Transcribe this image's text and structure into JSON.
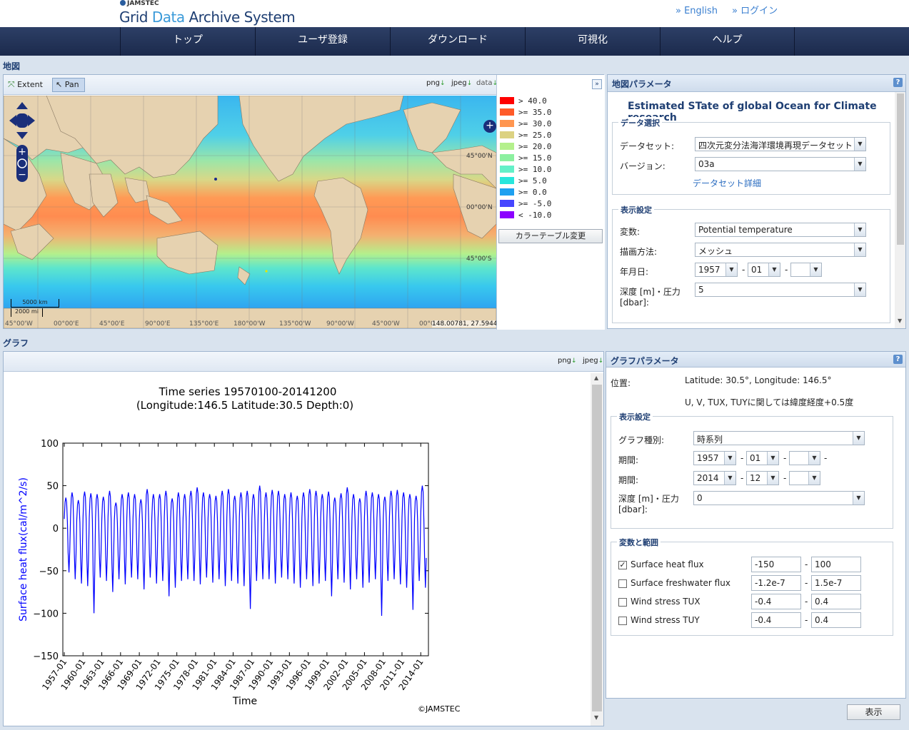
{
  "header": {
    "org": "JAMSTEC",
    "title_a": "Grid ",
    "title_b": "Data ",
    "title_c": "Archive ",
    "title_d": "System",
    "link_english": "» English",
    "link_login": "» ログイン"
  },
  "nav": [
    "トップ",
    "ユーザ登録",
    "ダウンロード",
    "可視化",
    "ヘルプ"
  ],
  "map_section": {
    "label": "地図",
    "extent_label": "Extent",
    "pan_label": "Pan",
    "png": "png",
    "jpeg": "jpeg",
    "data": "data",
    "lat_labels": [
      "45°00'N",
      "00°00'N",
      "45°00'S"
    ],
    "lon_labels": [
      "45°00'W",
      "00°00'E",
      "45°00'E",
      "90°00'E",
      "135°00'E",
      "180°00'W",
      "135°00'W",
      "90°00'W",
      "45°00'W",
      "00°0"
    ],
    "scale_km": "5000 km",
    "scale_mi": "2000 mi",
    "coords": "148.00781, 27.59440",
    "colortable_button": "カラーテーブル変更",
    "legend": [
      {
        "label": "> 40.0",
        "color": "#ff0000"
      },
      {
        "label": ">= 35.0",
        "color": "#ff5a28"
      },
      {
        "label": ">= 30.0",
        "color": "#ff9650"
      },
      {
        "label": ">= 25.0",
        "color": "#dcd282"
      },
      {
        "label": ">= 20.0",
        "color": "#b4f08c"
      },
      {
        "label": ">= 15.0",
        "color": "#8cf0a0"
      },
      {
        "label": ">= 10.0",
        "color": "#64f0c8"
      },
      {
        "label": ">= 5.0",
        "color": "#28e6dc"
      },
      {
        "label": ">= 0.0",
        "color": "#1ea0f0"
      },
      {
        "label": ">= -5.0",
        "color": "#4646ff"
      },
      {
        "label": "< -10.0",
        "color": "#8c00ff"
      }
    ]
  },
  "map_params": {
    "title": "地図パラメータ",
    "help": "?",
    "ecco_title": "Estimated STate of global Ocean for Climate research",
    "data_select_legend": "データ選択",
    "dataset_label": "データセット:",
    "dataset_value": "四次元変分法海洋環境再現データセット",
    "version_label": "バージョン:",
    "version_value": "03a",
    "dataset_detail_link": "データセット詳細",
    "display_legend": "表示設定",
    "variable_label": "変数:",
    "variable_value": "Potential temperature",
    "draw_label": "描画方法:",
    "draw_value": "メッシュ",
    "date_label": "年月日:",
    "year_value": "1957",
    "month_value": "01",
    "dash": "-",
    "depth_label_1": "深度 [m]・圧力",
    "depth_label_2": "[dbar]:",
    "depth_value": "5"
  },
  "graph_section": {
    "label": "グラフ",
    "png": "png",
    "jpeg": "jpeg",
    "copyright": "©JAMSTEC"
  },
  "graph_params": {
    "title": "グラフパラメータ",
    "help": "?",
    "position_label": "位置:",
    "position_value": "Latitude: 30.5°, Longitude: 146.5°",
    "uv_note": "U, V, TUX, TUYに関しては緯度経度+0.5度",
    "display_legend": "表示設定",
    "graph_type_label": "グラフ種別:",
    "graph_type_value": "時系列",
    "period_label": "期間:",
    "start_year": "1957",
    "start_month": "01",
    "end_year": "2014",
    "end_month": "12",
    "dash": "-",
    "depth_label_1": "深度 [m]・圧力",
    "depth_label_2": "[dbar]:",
    "depth_value": "0",
    "vars_legend": "変数と範囲",
    "variables": [
      {
        "name": "Surface heat flux",
        "checked": "✓",
        "min": "-150",
        "max": "100"
      },
      {
        "name": "Surface freshwater flux",
        "checked": "",
        "min": "-1.2e-7",
        "max": "1.5e-7"
      },
      {
        "name": "Wind stress TUX",
        "checked": "",
        "min": "-0.4",
        "max": "0.4"
      },
      {
        "name": "Wind stress TUY",
        "checked": "",
        "min": "-0.4",
        "max": "0.4"
      }
    ],
    "show_button": "表示"
  },
  "chart_data": {
    "type": "line",
    "title": "Time series 19570100-20141200",
    "subtitle": "(Longitude:146.5 Latitude:30.5 Depth:0)",
    "xlabel": "Time",
    "ylabel": "Surface heat flux(cal/m^2/s)",
    "ylim": [
      -150,
      100
    ],
    "yticks": [
      "100",
      "50",
      "0",
      "−50",
      "−100",
      "−150"
    ],
    "xticks": [
      "1957-01",
      "1960-01",
      "1963-01",
      "1966-01",
      "1969-01",
      "1972-01",
      "1975-01",
      "1978-01",
      "1981-01",
      "1984-01",
      "1987-01",
      "1990-01",
      "1993-01",
      "1996-01",
      "1999-01",
      "2002-01",
      "2005-01",
      "2008-01",
      "2011-01",
      "2014-01"
    ],
    "series": [
      {
        "name": "",
        "color": "#0000ff",
        "summer_peaks": [
          36,
          42,
          33,
          43,
          41,
          40,
          37,
          44,
          30,
          40,
          42,
          40,
          34,
          46,
          40,
          40,
          44,
          35,
          42,
          40,
          44,
          48,
          42,
          40,
          38,
          44,
          46,
          38,
          42,
          44,
          40,
          50,
          42,
          45,
          44,
          40,
          42,
          38,
          42,
          46,
          44,
          40,
          43,
          36,
          41,
          48,
          40,
          35,
          44,
          42,
          40,
          37,
          44,
          45,
          42,
          40,
          38,
          50
        ],
        "winter_troughs": [
          -52,
          -60,
          -65,
          -68,
          -100,
          -58,
          -62,
          -75,
          -60,
          -66,
          -58,
          -60,
          -72,
          -58,
          -65,
          -62,
          -80,
          -70,
          -62,
          -60,
          -62,
          -66,
          -58,
          -64,
          -60,
          -68,
          -62,
          -65,
          -68,
          -95,
          -62,
          -60,
          -60,
          -65,
          -58,
          -60,
          -65,
          -70,
          -60,
          -68,
          -65,
          -62,
          -80,
          -60,
          -64,
          -72,
          -60,
          -70,
          -64,
          -60,
          -103,
          -62,
          -60,
          -66,
          -70,
          -96,
          -62,
          -70
        ]
      }
    ]
  }
}
